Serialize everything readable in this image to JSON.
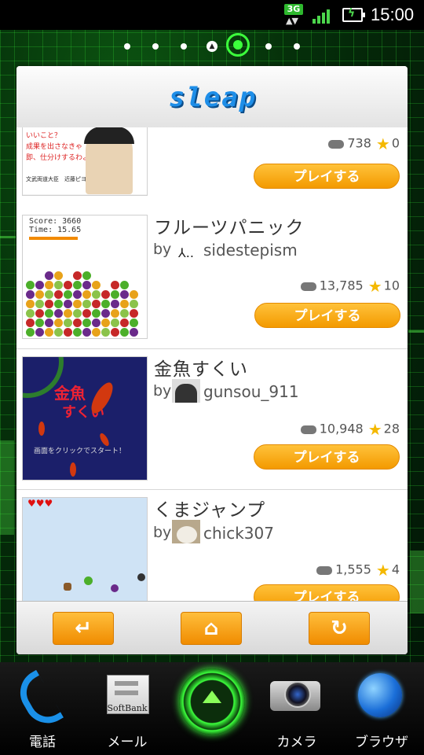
{
  "status_bar": {
    "network": "3G",
    "time": "15:00"
  },
  "widget": {
    "logo": "sleap",
    "games": [
      {
        "title": "",
        "author": "",
        "plays": "738",
        "stars": "0",
        "play_label": "プレイする",
        "thumb_lines": [
          "いいこと？",
          "成果を出さなきゃ",
          "即、仕分けするわよ！",
          "文武両道大臣　近藤ピヨチ"
        ]
      },
      {
        "title": "フルーツパニック",
        "by": "by",
        "author": "sidestepism",
        "plays": "13,785",
        "stars": "10",
        "play_label": "プレイする",
        "thumb_lines": [
          "Score: 3660",
          "Time: 15.65"
        ]
      },
      {
        "title": "金魚すくい",
        "by": "by",
        "author": "gunsou_911",
        "plays": "10,948",
        "stars": "28",
        "play_label": "プレイする",
        "thumb_lines": [
          "金魚",
          "すくい",
          "画面をクリックでスタート！"
        ]
      },
      {
        "title": "くまジャンプ",
        "by": "by",
        "author": "chick307",
        "plays": "1,555",
        "stars": "4",
        "play_label": "プレイする",
        "thumb_lines": [
          "♥♥♥"
        ]
      }
    ],
    "toolbar": {
      "back_icon": "back-arrow-icon",
      "home_icon": "home-icon",
      "refresh_icon": "refresh-icon"
    }
  },
  "dock": {
    "phone": "電話",
    "mail": "メール",
    "mail_badge": "SoftBank",
    "camera": "カメラ",
    "browser": "ブラウザ"
  },
  "colors": {
    "accent_orange": "#f39a00",
    "star": "#f4b800",
    "wallpaper_green": "#3cff3c"
  }
}
